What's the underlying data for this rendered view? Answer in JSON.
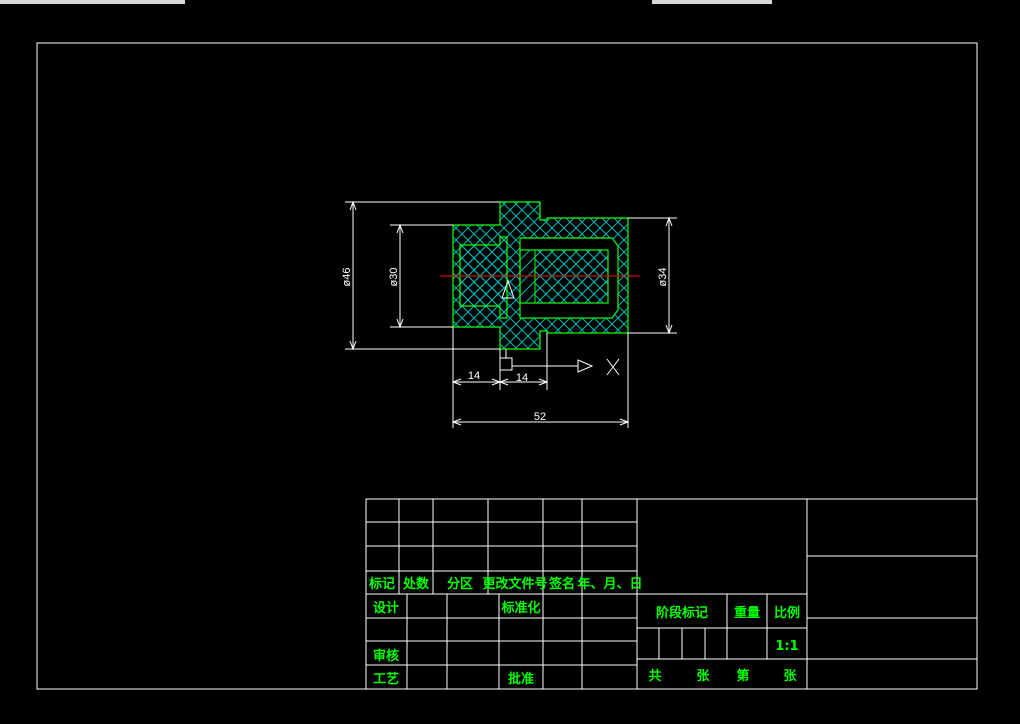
{
  "dimensions": {
    "dia_outer": "ø46",
    "dia_bore": "ø30",
    "dia_right": "ø34",
    "len_left": "14",
    "len_mid": "14",
    "len_total": "52"
  },
  "axis_label": "X",
  "title_block": {
    "row_mark": "标记",
    "row_count": "处数",
    "row_zone": "分区",
    "row_doc": "更改文件号",
    "row_sign": "签名",
    "row_date": "年、月、日",
    "design": "设计",
    "standardize": "标准化",
    "review": "审核",
    "process": "工艺",
    "approve": "批准",
    "stage_mark": "阶段标记",
    "weight": "重量",
    "scale": "比例",
    "scale_value": "1:1",
    "total": "共",
    "sheets": "张",
    "number": "第",
    "sheet": "张"
  },
  "colors": {
    "line": "#ffffff",
    "part_outline": "#00ff00",
    "hatch": "#00b4b4",
    "centerline": "#ff0000",
    "text": "#00ff00"
  }
}
